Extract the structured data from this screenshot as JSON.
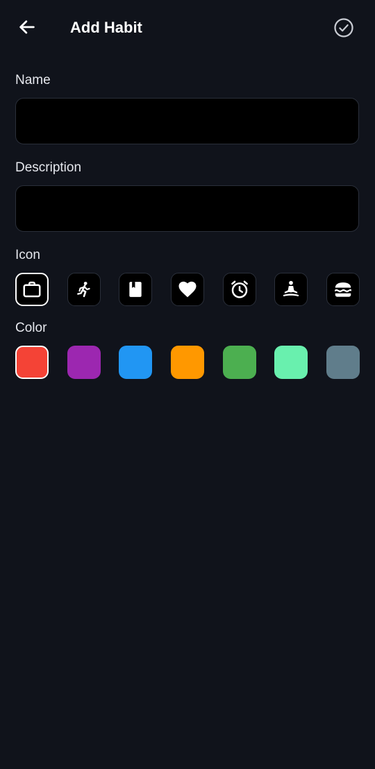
{
  "header": {
    "title": "Add Habit",
    "back_icon": "arrow-left-icon",
    "save_icon": "check-circle-icon"
  },
  "form": {
    "name_label": "Name",
    "name_value": "",
    "description_label": "Description",
    "description_value": "",
    "icon_label": "Icon",
    "color_label": "Color"
  },
  "icons": [
    {
      "name": "briefcase-icon",
      "selected": true
    },
    {
      "name": "running-icon",
      "selected": false
    },
    {
      "name": "book-icon",
      "selected": false
    },
    {
      "name": "heart-icon",
      "selected": false
    },
    {
      "name": "alarm-clock-icon",
      "selected": false
    },
    {
      "name": "meditation-icon",
      "selected": false
    },
    {
      "name": "burger-icon",
      "selected": false
    }
  ],
  "colors": [
    {
      "name": "red",
      "hex": "#f44336",
      "selected": true
    },
    {
      "name": "purple",
      "hex": "#9c27b0",
      "selected": false
    },
    {
      "name": "blue",
      "hex": "#2196f3",
      "selected": false
    },
    {
      "name": "orange",
      "hex": "#ff9800",
      "selected": false
    },
    {
      "name": "green",
      "hex": "#4caf50",
      "selected": false
    },
    {
      "name": "mint",
      "hex": "#69f0ae",
      "selected": false
    },
    {
      "name": "blue-grey",
      "hex": "#607d8b",
      "selected": false
    }
  ],
  "theme": {
    "background": "#10131b",
    "field_background": "#000000",
    "text": "#ffffff"
  }
}
